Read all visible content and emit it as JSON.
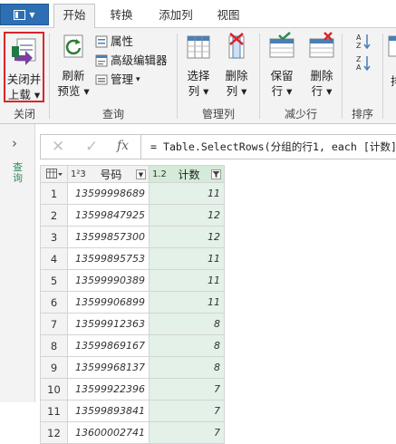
{
  "tabs": {
    "file_label": "",
    "items": [
      "开始",
      "转换",
      "添加列",
      "视图"
    ]
  },
  "ribbon": {
    "close_group": {
      "button_line1": "关闭并",
      "button_line2": "上载",
      "group_label": "关闭"
    },
    "query_group": {
      "refresh_line1": "刷新",
      "refresh_line2": "预览",
      "properties": "属性",
      "advanced_editor": "高级编辑器",
      "manage": "管理",
      "group_label": "查询"
    },
    "manage_cols_group": {
      "choose_line1": "选择",
      "choose_line2": "列",
      "remove_line1": "删除",
      "remove_line2": "列",
      "group_label": "管理列"
    },
    "reduce_rows_group": {
      "keep_line1": "保留",
      "keep_line2": "行",
      "remove_line1": "删除",
      "remove_line2": "行",
      "group_label": "减少行"
    },
    "sort_group": {
      "group_label": "排序"
    },
    "extra_visible": "排"
  },
  "left_pane": {
    "vertical_label": "查询"
  },
  "formula_bar": {
    "fx": "fx",
    "formula": "= Table.SelectRows(分组的行1, each [计数]"
  },
  "table": {
    "columns": [
      {
        "type_tag": "1²3",
        "name": "号码"
      },
      {
        "type_tag": "1.2",
        "name": "计数"
      }
    ],
    "rows": [
      {
        "n": "1",
        "phone": "13599998689",
        "count": "11"
      },
      {
        "n": "2",
        "phone": "13599847925",
        "count": "12"
      },
      {
        "n": "3",
        "phone": "13599857300",
        "count": "12"
      },
      {
        "n": "4",
        "phone": "13599895753",
        "count": "11"
      },
      {
        "n": "5",
        "phone": "13599990389",
        "count": "11"
      },
      {
        "n": "6",
        "phone": "13599906899",
        "count": "11"
      },
      {
        "n": "7",
        "phone": "13599912363",
        "count": "8"
      },
      {
        "n": "8",
        "phone": "13599869167",
        "count": "8"
      },
      {
        "n": "9",
        "phone": "13599968137",
        "count": "8"
      },
      {
        "n": "10",
        "phone": "13599922396",
        "count": "7"
      },
      {
        "n": "11",
        "phone": "13599893841",
        "count": "7"
      },
      {
        "n": "12",
        "phone": "13600002741",
        "count": "7"
      }
    ]
  },
  "colors": {
    "file_blue": "#2e6fb3",
    "selection_red": "#d9252a",
    "filtered_column_green": "#e3f1e8",
    "query_label_green": "#2e8b57"
  }
}
